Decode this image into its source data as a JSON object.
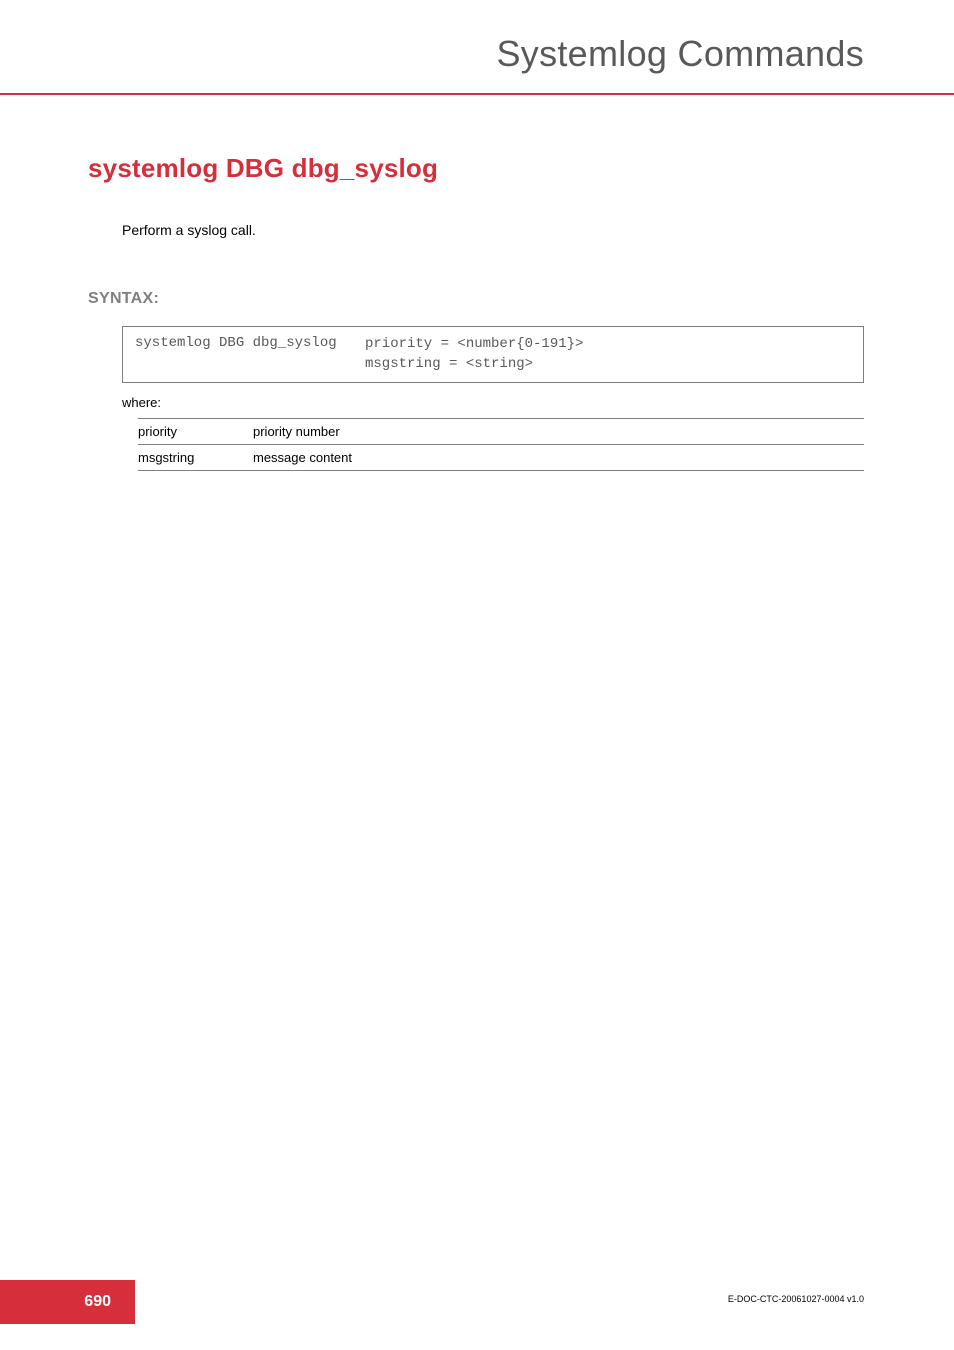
{
  "header": {
    "title": "Systemlog Commands"
  },
  "command": {
    "title": "systemlog DBG dbg_syslog",
    "description": "Perform a syslog call."
  },
  "syntax": {
    "label": "SYNTAX:",
    "command": "systemlog DBG dbg_syslog",
    "args": [
      "priority = <number{0-191}>",
      "msgstring = <string>"
    ],
    "where_label": "where:"
  },
  "params": [
    {
      "name": "priority",
      "desc": "priority number"
    },
    {
      "name": "msgstring",
      "desc": "message content"
    }
  ],
  "footer": {
    "page": "690",
    "docref": "E-DOC-CTC-20061027-0004 v1.0"
  }
}
